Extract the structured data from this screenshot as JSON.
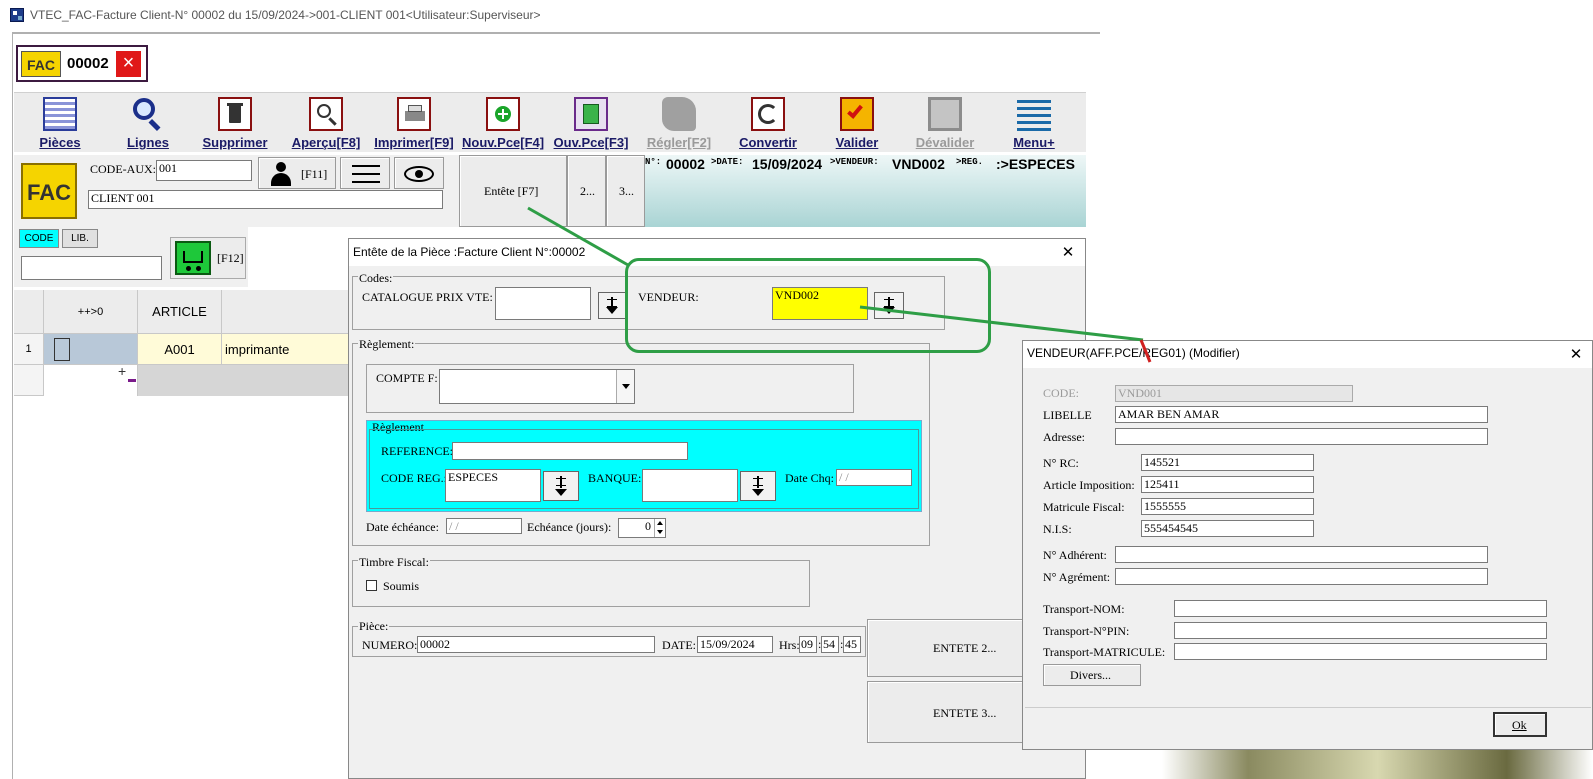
{
  "window": {
    "title": "VTEC_FAC-Facture Client-N° 00002 du 15/09/2024->001-CLIENT 001<Utilisateur:Superviseur>"
  },
  "doc_tab": {
    "badge": "FAC",
    "number": "00002",
    "close": "×"
  },
  "toolbar": {
    "pieces": "Pièces",
    "lignes": "Lignes",
    "supprimer": "Supprimer",
    "apercu": "Aperçu[F8]",
    "imprimer": "Imprimer[F9]",
    "nouv": "Nouv.Pce[F4]",
    "ouv": "Ouv.Pce[F3]",
    "regler": "Régler[F2]",
    "convertir": "Convertir",
    "valider": "Valider",
    "devalider": "Dévalider",
    "menu": "Menu+"
  },
  "header": {
    "logo": "FAC",
    "code_aux_label": "CODE-AUX:",
    "code_aux_value": "001",
    "f11": "[F11]",
    "client_name": "CLIENT 001",
    "entete_btn": "Entête [F7]",
    "btn2": "2...",
    "btn3": "3...",
    "info": {
      "n_label": "N°:",
      "n_value": "00002",
      "date_label": ">DATE:",
      "date_value": "15/09/2024",
      "vend_label": ">VENDEUR:",
      "vend_value": "VND002",
      "reg_label": ">REG.",
      "reg_value": ":>ESPECES"
    }
  },
  "search": {
    "code_tab": "CODE",
    "lib_tab": "LIB.",
    "f12": "[F12]"
  },
  "grid": {
    "headers": [
      "++>0",
      "ARTICLE",
      ""
    ],
    "rows": [
      {
        "num": "1",
        "article": "A001",
        "designation": "imprimante"
      }
    ],
    "add": "+"
  },
  "entete_dialog": {
    "title": "Entête de la Pièce :Facture Client N°:00002",
    "close": "✕",
    "codes_group": "Codes:",
    "catalogue_label": "CATALOGUE PRIX VTE:",
    "catalogue_value": "",
    "vendeur_label": "VENDEUR:",
    "vendeur_value": "VND002",
    "reglement_group": "Règlement:",
    "compte_label": "COMPTE F:",
    "compte_value": "",
    "reglement_inner": "Règlement",
    "reference_label": "REFERENCE:",
    "reference_value": "",
    "code_reg_label": "CODE REG.:",
    "code_reg_value": "ESPECES",
    "banque_label": "BANQUE:",
    "banque_value": "",
    "date_chq_label": "Date Chq:",
    "date_chq_value": " / /",
    "date_echeance_label": "Date échéance:",
    "date_echeance_value": " / /",
    "echeance_label": "Echéance (jours):",
    "echeance_value": "0",
    "timbre_group": "Timbre Fiscal:",
    "soumis_label": "Soumis",
    "piece_group": "Pièce:",
    "numero_label": "NUMERO:",
    "numero_value": "00002",
    "date_label": "DATE:",
    "date_value": "15/09/2024",
    "hrs_label": "Hrs:",
    "hh": "09",
    "mm": "54",
    "ss": "45",
    "entete2_btn": "ENTETE 2...",
    "entete3_btn": "ENTETE 3..."
  },
  "vendeur_dialog": {
    "title": "VENDEUR(AFF.PCE/REG01)  (Modifier)",
    "close": "✕",
    "code_label": "CODE:",
    "code_value": "VND001",
    "libelle_label": "LIBELLE",
    "libelle_value": "AMAR BEN AMAR",
    "adresse_label": "Adresse:",
    "adresse_value": "",
    "rc_label": "N° RC:",
    "rc_value": "145521",
    "article_label": "Article Imposition:",
    "article_value": "125411",
    "matricule_label": "Matricule Fiscal:",
    "matricule_value": "1555555",
    "nis_label": "N.I.S:",
    "nis_value": "555454545",
    "adherent_label": "N° Adhérent:",
    "adherent_value": "",
    "agrement_label": "N° Agrément:",
    "agrement_value": "",
    "transport_nom_label": "Transport-NOM:",
    "transport_nom_value": "",
    "transport_pin_label": "Transport-N°PIN:",
    "transport_pin_value": "",
    "transport_mat_label": "Transport-MATRICULE:",
    "transport_mat_value": "",
    "divers_btn": "Divers...",
    "ok_btn": "Ok"
  },
  "colors": {
    "highlight_yellow": "#ffff00",
    "reglement_cyan": "#00ffff",
    "annotation_green": "#2e9e46",
    "annotation_red": "#d02020",
    "info_bar": "#a9d4d4"
  }
}
